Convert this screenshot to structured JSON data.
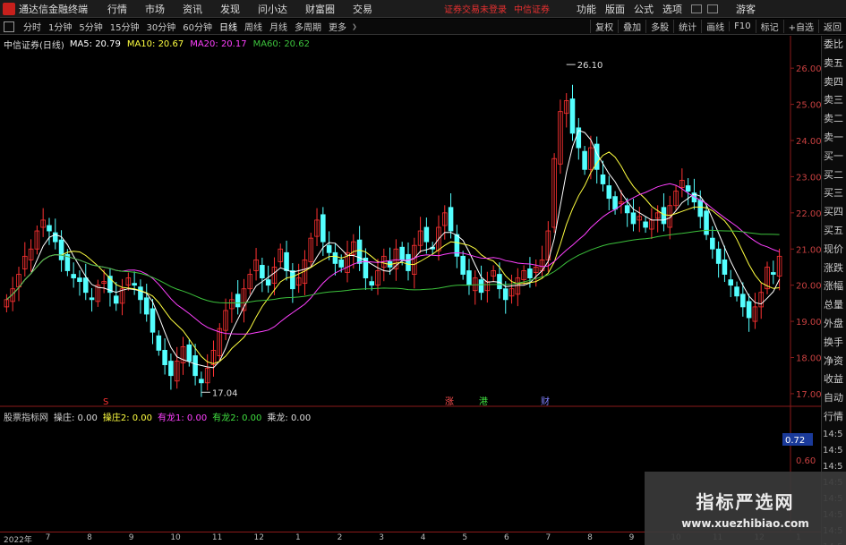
{
  "window": {
    "app_title": "通达信金融终端",
    "menu": [
      "行情",
      "市场",
      "资讯",
      "发现",
      "问小达",
      "财富圈",
      "交易"
    ],
    "notice": "证券交易未登录",
    "broker": "中信证券",
    "right_menu": [
      "功能",
      "版面",
      "公式",
      "选项"
    ],
    "guest_label": "游客"
  },
  "toolbar": {
    "periods": [
      "分时",
      "1分钟",
      "5分钟",
      "15分钟",
      "30分钟",
      "60分钟",
      "日线",
      "周线",
      "月线",
      "多周期",
      "更多"
    ],
    "active_period": "日线",
    "tools": [
      "复权",
      "叠加",
      "多股",
      "统计",
      "画线",
      "F10",
      "标记",
      "+自选",
      "返回"
    ]
  },
  "chart_header": {
    "stock_title": "中信证券(日线)",
    "ma5": "MA5: 20.79",
    "ma10": "MA10: 20.67",
    "ma20": "MA20: 20.17",
    "ma60": "MA60: 20.62"
  },
  "colors": {
    "up": "#ff3232",
    "down": "#54ffff",
    "ma5": "#ffffff",
    "ma10": "#ffff40",
    "ma20": "#ff40ff",
    "ma60": "#3cc23c",
    "axis": "#8a1a1a"
  },
  "annotations": {
    "high": "26.10",
    "low": "17.04"
  },
  "events": [
    {
      "label": "S",
      "color": "#ff3232"
    },
    {
      "label": "涨",
      "color": "#ff5050"
    },
    {
      "label": "港",
      "color": "#40e040"
    },
    {
      "label": "财",
      "color": "#8080ff"
    }
  ],
  "indicator": {
    "name": "股票指标网",
    "items": [
      {
        "label": "操庄: 0.00",
        "color": "#dddddd"
      },
      {
        "label": "操庄2: 0.00",
        "color": "#ffff40"
      },
      {
        "label": "有龙1: 0.00",
        "color": "#ff40ff"
      },
      {
        "label": "有龙2: 0.00",
        "color": "#40e040"
      },
      {
        "label": "乘龙: 0.00",
        "color": "#dddddd"
      }
    ],
    "value_box": "0.72",
    "axis_value": "0.60"
  },
  "right_panel": {
    "items": [
      "委比",
      "卖五",
      "卖四",
      "卖三",
      "卖二",
      "卖一",
      "买一",
      "买二",
      "买三",
      "买四",
      "买五",
      "现价",
      "涨跌",
      "涨幅",
      "总量",
      "外盘",
      "换手",
      "净资",
      "收益",
      "自动",
      "行情"
    ],
    "times": [
      "14:5",
      "14:5",
      "14:5",
      "14:5",
      "14:5",
      "14:5",
      "14:5",
      "14:5"
    ]
  },
  "watermark": {
    "title": "指标严选网",
    "url": "www.xuezhibiao.com"
  },
  "chart_data": {
    "type": "candlestick",
    "title": "中信证券(日线)",
    "y_ticks": [
      "26.00",
      "25.00",
      "24.00",
      "23.00",
      "22.00",
      "21.00",
      "20.00",
      "19.00",
      "18.00",
      "17.00"
    ],
    "ylim": [
      16.8,
      26.4
    ],
    "date_labels": [
      "2022年",
      "7",
      "8",
      "9",
      "10",
      "11",
      "12",
      "1",
      "2",
      "3",
      "4",
      "5",
      "6",
      "7",
      "8",
      "9",
      "10",
      "11",
      "12",
      "1"
    ],
    "close": [
      19.6,
      19.9,
      20.3,
      20.8,
      21.0,
      21.5,
      21.8,
      21.5,
      21.2,
      20.7,
      20.4,
      20.2,
      20.1,
      19.8,
      19.6,
      20.0,
      20.1,
      19.8,
      19.5,
      19.9,
      20.2,
      20.0,
      19.6,
      19.2,
      18.7,
      18.2,
      17.8,
      17.5,
      17.9,
      18.3,
      17.9,
      17.5,
      17.3,
      17.7,
      18.2,
      18.8,
      19.3,
      19.6,
      19.4,
      19.9,
      20.3,
      20.7,
      20.2,
      20.0,
      20.5,
      21.0,
      20.4,
      19.9,
      20.2,
      20.7,
      21.3,
      21.8,
      21.2,
      20.9,
      20.6,
      20.5,
      20.9,
      21.2,
      20.6,
      20.2,
      20.0,
      20.4,
      20.8,
      20.5,
      21.0,
      20.7,
      20.4,
      21.1,
      21.5,
      21.2,
      21.0,
      21.6,
      22.0,
      21.5,
      20.8,
      20.3,
      20.0,
      20.2,
      19.8,
      20.1,
      20.4,
      19.9,
      19.6,
      19.9,
      20.2,
      20.4,
      20.2,
      20.5,
      20.7,
      21.5,
      23.5,
      24.8,
      25.1,
      24.2,
      23.8,
      23.2,
      23.8,
      23.2,
      22.8,
      22.4,
      22.1,
      22.3,
      22.0,
      21.7,
      21.9,
      21.6,
      21.8,
      22.0,
      21.7,
      22.2,
      22.6,
      22.9,
      22.6,
      22.3,
      21.9,
      21.4,
      21.0,
      20.6,
      20.3,
      20.0,
      19.7,
      19.4,
      19.1,
      19.4,
      19.8,
      20.5,
      20.3,
      20.8
    ],
    "volume_indicator": [
      0.72
    ],
    "high_label": "26.10",
    "low_label": "17.04"
  }
}
